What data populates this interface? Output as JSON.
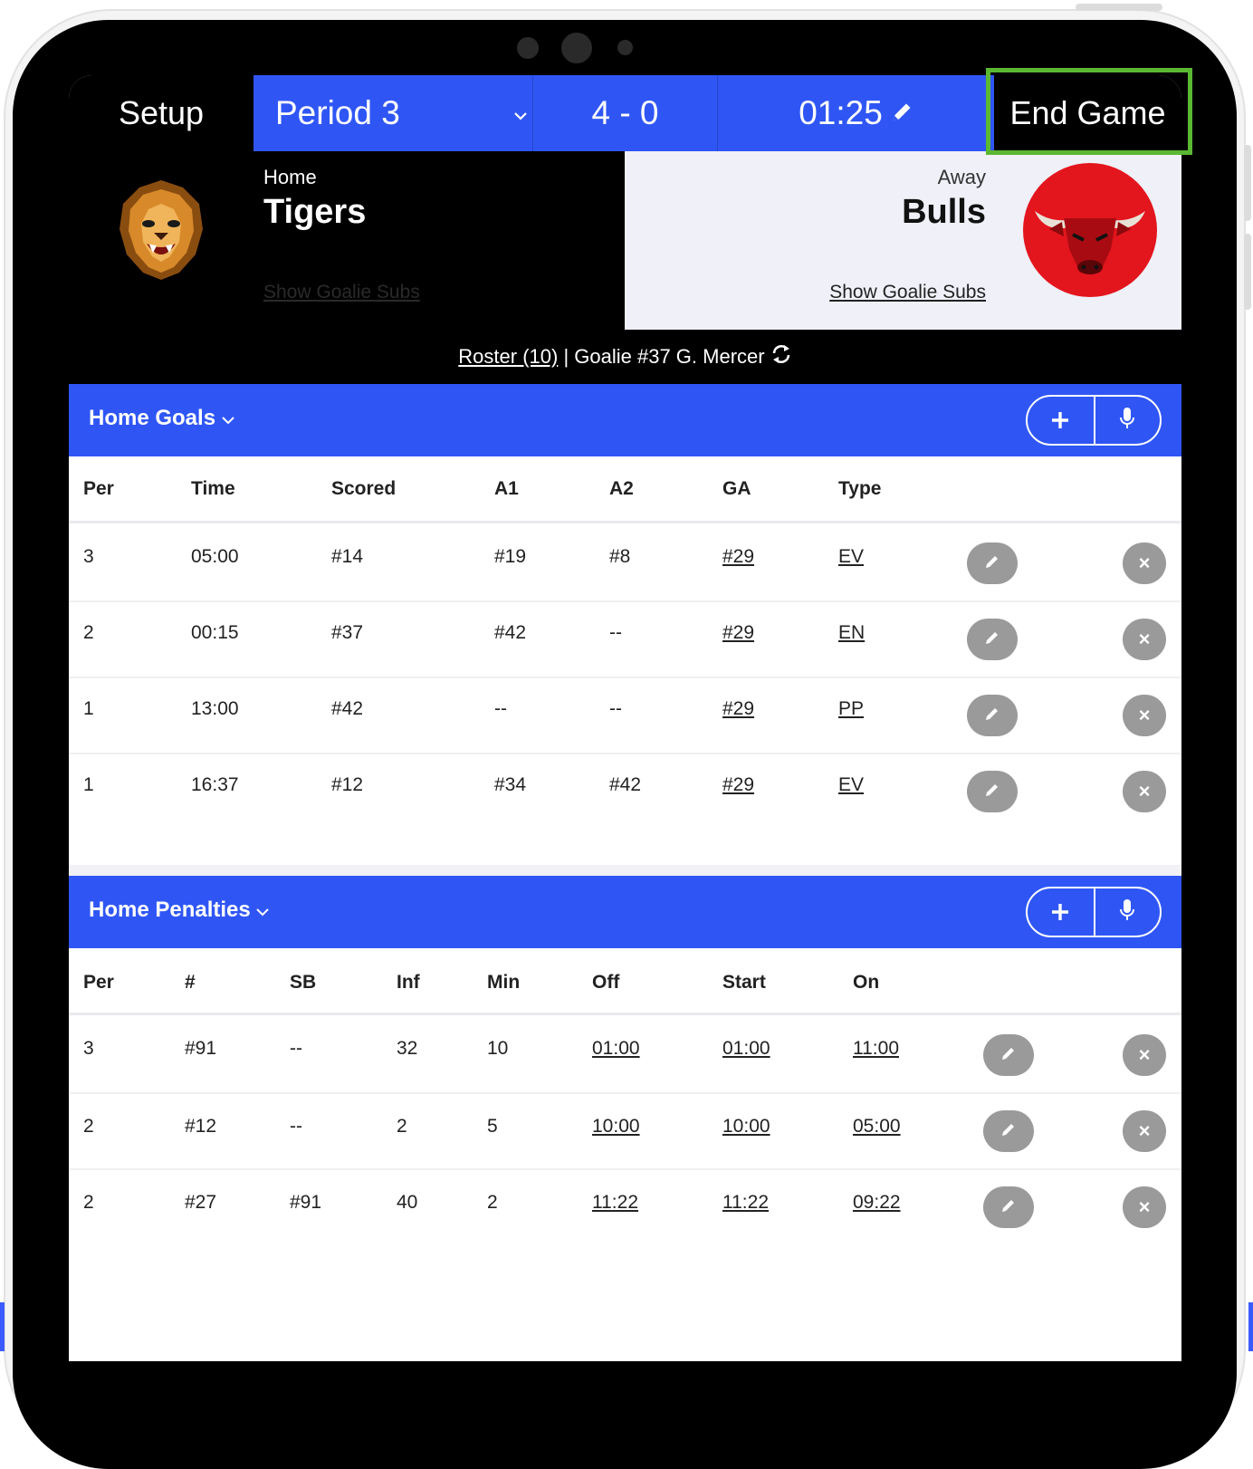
{
  "topbar": {
    "setup": "Setup",
    "period": "Period 3",
    "score": "4 - 0",
    "clock": "01:25",
    "end_game": "End Game"
  },
  "home": {
    "label": "Home",
    "name": "Tigers",
    "goalie_subs": "Show Goalie Subs"
  },
  "away": {
    "label": "Away",
    "name": "Bulls",
    "goalie_subs": "Show Goalie Subs"
  },
  "roster": {
    "link": "Roster (10)",
    "goalie": " | Goalie #37 G. Mercer "
  },
  "goals": {
    "title": "Home Goals",
    "headers": [
      "Per",
      "Time",
      "Scored",
      "A1",
      "A2",
      "GA",
      "Type"
    ],
    "rows": [
      [
        "3",
        "05:00",
        "#14",
        "#19",
        "#8",
        "#29",
        "EV"
      ],
      [
        "2",
        "00:15",
        "#37",
        "#42",
        "--",
        "#29",
        "EN"
      ],
      [
        "1",
        "13:00",
        "#42",
        "--",
        "--",
        "#29",
        "PP"
      ],
      [
        "1",
        "16:37",
        "#12",
        "#34",
        "#42",
        "#29",
        "EV"
      ]
    ]
  },
  "penalties": {
    "title": "Home Penalties",
    "headers": [
      "Per",
      "#",
      "SB",
      "Inf",
      "Min",
      "Off",
      "Start",
      "On"
    ],
    "rows": [
      [
        "3",
        "#91",
        "--",
        "32",
        "10",
        "01:00",
        "01:00",
        "11:00"
      ],
      [
        "2",
        "#12",
        "--",
        "2",
        "5",
        "10:00",
        "10:00",
        "05:00"
      ],
      [
        "2",
        "#27",
        "#91",
        "40",
        "2",
        "11:22",
        "11:22",
        "09:22"
      ]
    ]
  },
  "colors": {
    "accent": "#2f56f5",
    "highlight": "#5ab832",
    "button_gray": "#9a9a9a"
  }
}
